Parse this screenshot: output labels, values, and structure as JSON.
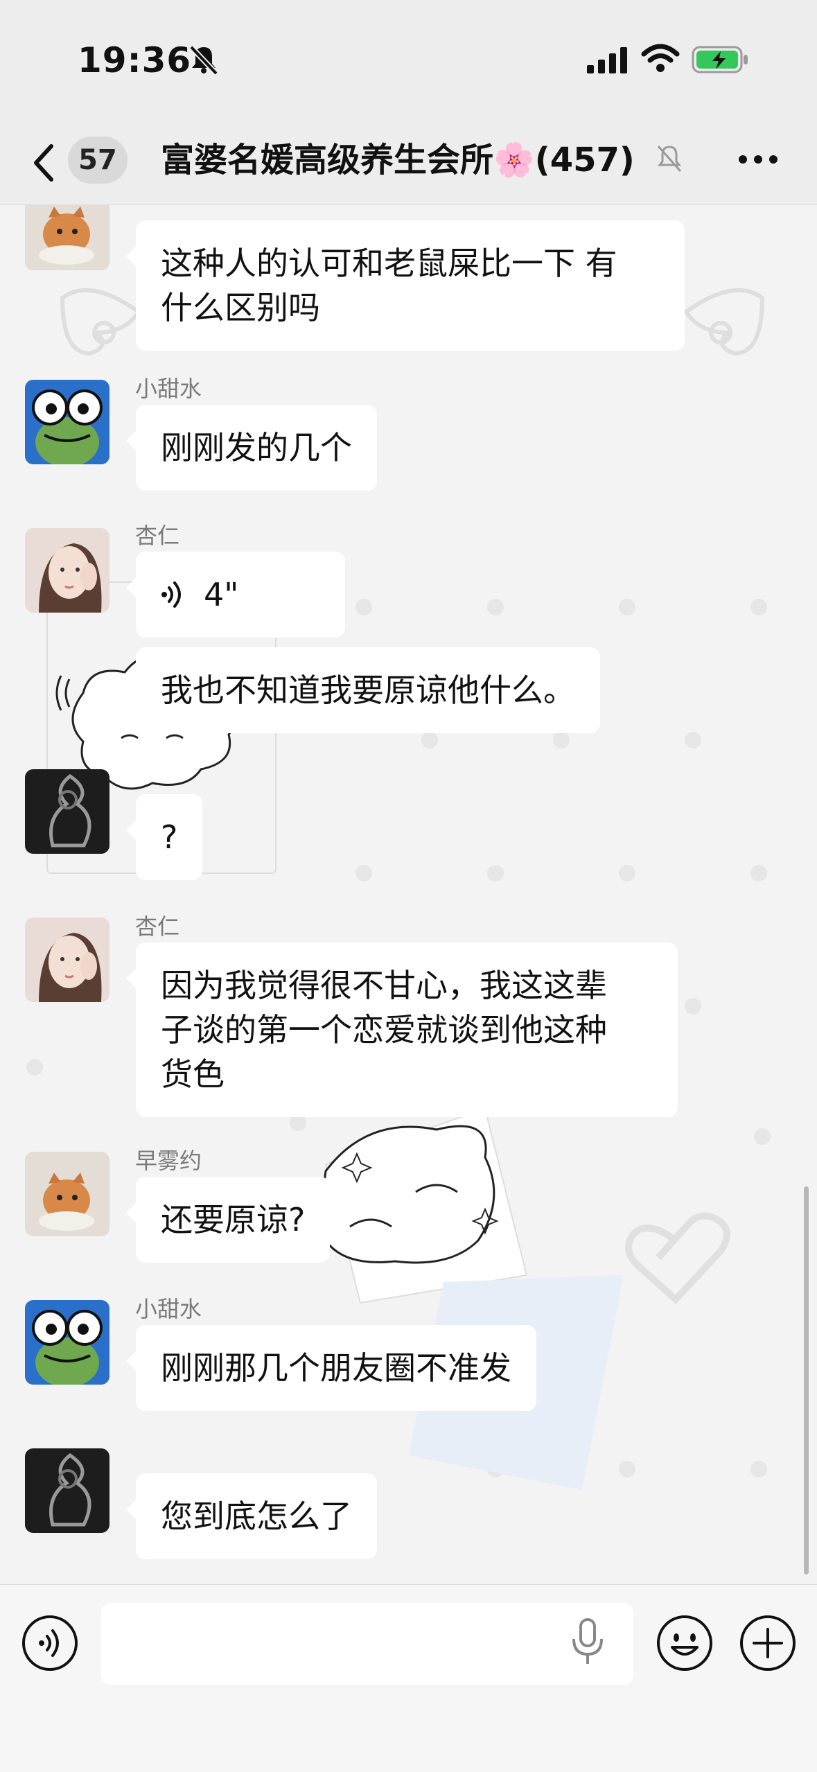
{
  "status_bar": {
    "time": "19:36"
  },
  "nav": {
    "unread_count": "57",
    "chat_title": "富婆名媛高级养生会所🌸(457)"
  },
  "messages": [
    {
      "sender": "",
      "text": "这种人的认可和老鼠屎比一下 有\n什么区别吗"
    },
    {
      "sender": "小甜水",
      "text": "刚刚发的几个"
    },
    {
      "sender": "杏仁",
      "voice_duration": "4\"",
      "text": "我也不知道我要原谅他什么。"
    },
    {
      "sender": "",
      "text": "?"
    },
    {
      "sender": "杏仁",
      "text": "因为我觉得很不甘心，我这这辈\n子谈的第一个恋爱就谈到他这种\n货色"
    },
    {
      "sender": "早雾约",
      "text": "还要原谅?"
    },
    {
      "sender": "小甜水",
      "text": "刚刚那几个朋友圈不准发"
    },
    {
      "sender": "",
      "text": "您到底怎么了"
    }
  ],
  "colors": {
    "bubble": "#ffffff",
    "background": "#f3f3f3",
    "battery": "#34c759"
  }
}
